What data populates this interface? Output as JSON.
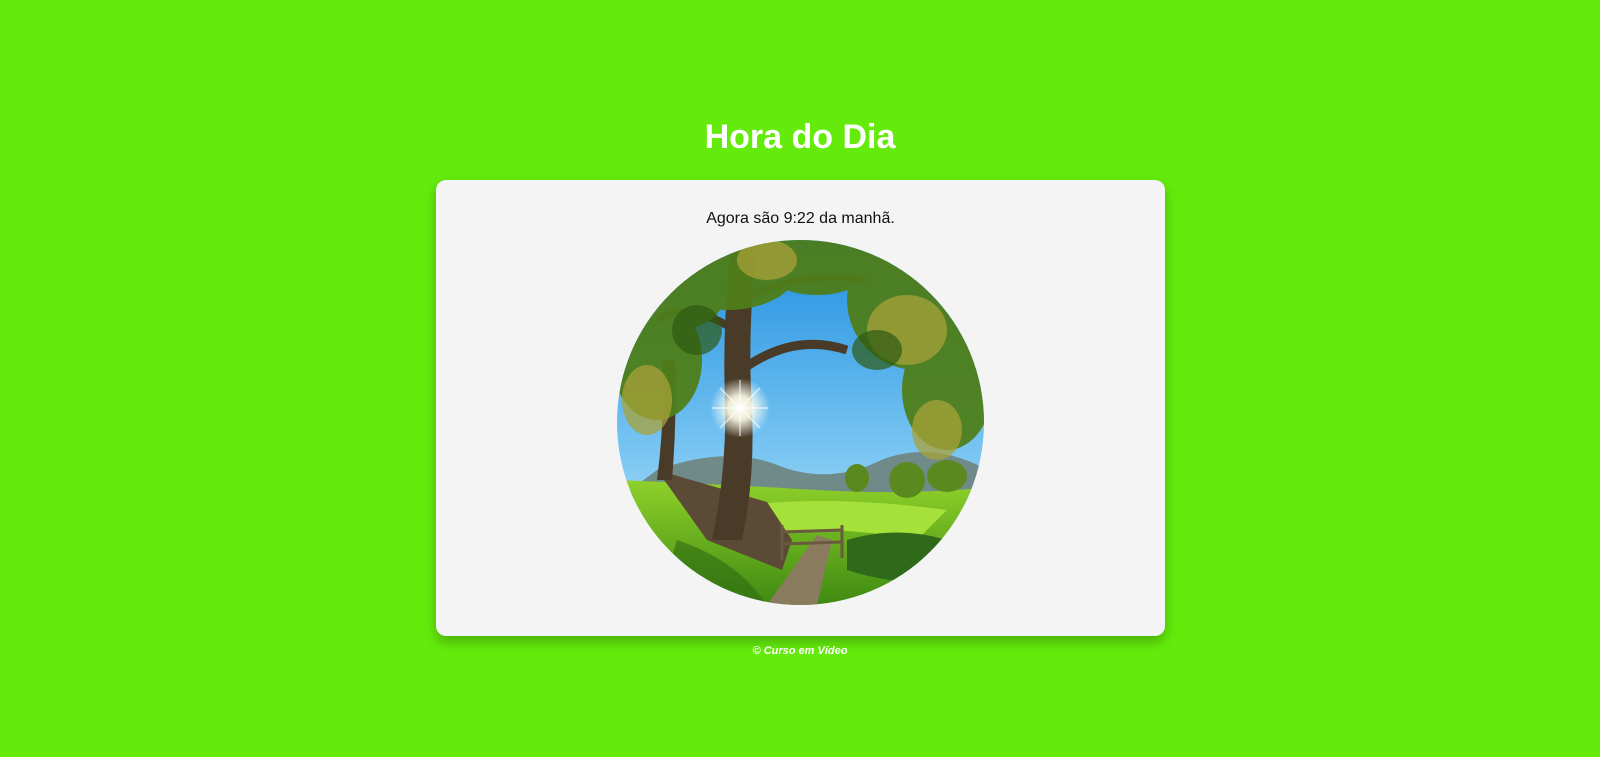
{
  "page": {
    "title": "Hora do Dia",
    "message": "Agora são 9:22 da manhã.",
    "footer": "© Curso em Vídeo"
  },
  "image": {
    "subject": "morning-landscape",
    "shape": "circle"
  },
  "colors": {
    "background": "#64eb0c",
    "card": "#f4f4f4",
    "title": "#ffffff",
    "text": "#111111"
  }
}
